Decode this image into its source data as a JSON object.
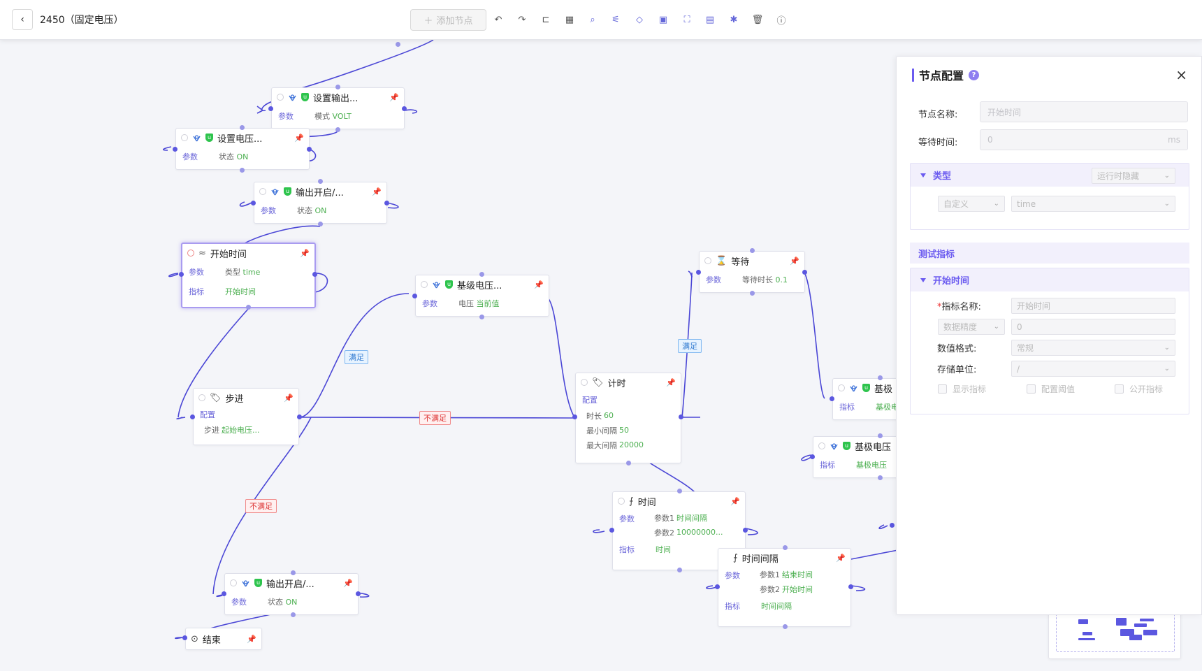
{
  "header": {
    "back_label": "‹",
    "title": "2450（固定电压）",
    "add_node_label": "添加节点",
    "toolbar_icons": [
      "undo-icon",
      "redo-icon",
      "branch-icon",
      "layout-icon",
      "search-icon",
      "filter-icon",
      "tag-icon",
      "frame-icon",
      "fullscreen-icon",
      "save-icon",
      "debug-icon",
      "delete-icon",
      "help-icon"
    ]
  },
  "nodes": {
    "set_output": {
      "title": "设置输出...",
      "p_label": "参数",
      "p_key": "模式",
      "p_val": "VOLT"
    },
    "set_voltage": {
      "title": "设置电压...",
      "p_label": "参数",
      "p_key": "状态",
      "p_val": "ON"
    },
    "output_on_1": {
      "title": "输出开启/...",
      "p_label": "参数",
      "p_key": "状态",
      "p_val": "ON"
    },
    "start_time": {
      "title": "开始时间",
      "p_label": "参数",
      "p_key": "类型",
      "p_val": "time",
      "m_label": "指标",
      "m_val": "开始时间"
    },
    "base_voltage_1": {
      "title": "基级电压...",
      "p_label": "参数",
      "p_key": "电压",
      "p_val": "当前值"
    },
    "step": {
      "title": "步进",
      "c_label": "配置",
      "s_key": "步进",
      "s_val": "起始电压..."
    },
    "timer": {
      "title": "计时",
      "c_label": "配置",
      "l1k": "时长",
      "l1v": "60",
      "l2k": "最小间隔",
      "l2v": "50",
      "l3k": "最大间隔",
      "l3v": "20000"
    },
    "wait": {
      "title": "等待",
      "p_label": "参数",
      "p_key": "等待时长",
      "p_val": "0.1"
    },
    "time": {
      "title": "时间",
      "p_label": "参数",
      "l1k": "参数1",
      "l1v": "时间间隔",
      "l2k": "参数2",
      "l2v": "10000000...",
      "m_label": "指标",
      "m_val": "时间"
    },
    "interval": {
      "title": "时间间隔",
      "p_label": "参数",
      "l1k": "参数1",
      "l1v": "结束时间",
      "l2k": "参数2",
      "l2v": "开始时间",
      "m_label": "指标",
      "m_val": "时间间隔"
    },
    "base_voltage_2": {
      "title": "基极",
      "m_label": "指标",
      "m_val": "基极电"
    },
    "base_voltage_3": {
      "title": "基极电压",
      "m_label": "指标",
      "m_val": "基极电压"
    },
    "output_on_2": {
      "title": "输出开启/...",
      "p_label": "参数",
      "p_key": "状态",
      "p_val": "ON"
    },
    "end": {
      "title": "结束"
    }
  },
  "edge_labels": {
    "step_ok": "满足",
    "step_no": "不满足",
    "step_no2": "不满足",
    "timer_ok": "满足"
  },
  "panel": {
    "title": "节点配置",
    "help": "?",
    "close": "×",
    "name_label": "节点名称:",
    "name_placeholder": "开始时间",
    "wait_label": "等待时间:",
    "wait_placeholder": "0",
    "wait_unit": "ms",
    "type_section": "类型",
    "type_runtime": "运行时隐藏",
    "type_custom": "自定义",
    "type_value": "time",
    "test_metric_title": "测试指标",
    "metric_section": "开始时间",
    "metric_name_label": "指标名称:",
    "metric_name_required": "*",
    "metric_name_placeholder": "开始时间",
    "precision_label": "数据精度",
    "precision_value": "0",
    "format_label": "数值格式:",
    "format_value": "常规",
    "unit_label": "存储单位:",
    "unit_value": "/",
    "cb_show": "显示指标",
    "cb_threshold": "配置阈值",
    "cb_public": "公开指标"
  },
  "colors": {
    "accent": "#6b5bf0",
    "edge": "#4b47d6",
    "success": "#4caf50"
  }
}
